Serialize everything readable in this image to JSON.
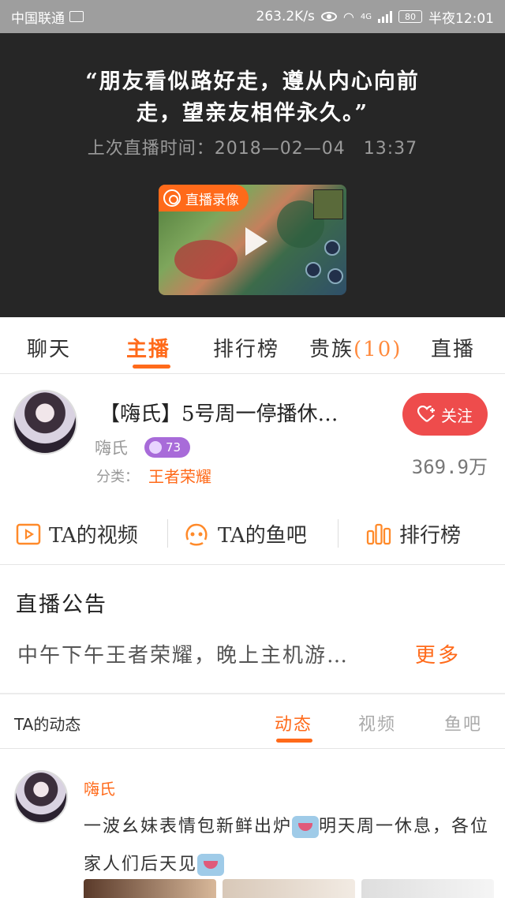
{
  "status_bar": {
    "carrier": "中国联通",
    "speed": "263.2K/s",
    "network": "4G",
    "battery": "80",
    "time": "半夜12:01"
  },
  "hero": {
    "quote_line1": "“朋友看似路好走，遵从内心向前",
    "quote_line2": "走，望亲友相伴永久。”",
    "last_live": "上次直播时间：2018—02—04　13:37",
    "replay_label": "直播录像"
  },
  "tabs": [
    {
      "label": "聊天"
    },
    {
      "label": "主播"
    },
    {
      "label": "排行榜"
    },
    {
      "label": "贵族",
      "count": "(10)"
    },
    {
      "label": "直播"
    }
  ],
  "anchor": {
    "title": "【嗨氏】5号周一停播休…",
    "name": "嗨氏",
    "level": "73",
    "category_label": "分类：",
    "category": "王者荣耀",
    "follow_label": "关注",
    "fans": "369.9万"
  },
  "actions": [
    {
      "label": "TA的视频",
      "icon": "video-icon"
    },
    {
      "label": "TA的鱼吧",
      "icon": "fishbar-icon"
    },
    {
      "label": "排行榜",
      "icon": "ranking-icon"
    }
  ],
  "notice": {
    "title": "直播公告",
    "text": "中午下午王者荣耀，晚上主机游…",
    "more": "更多"
  },
  "dynamics": {
    "label": "TA的动态",
    "tabs": [
      "动态",
      "视频",
      "鱼吧"
    ]
  },
  "post": {
    "author": "嗨氏",
    "text_part1": "一波幺妹表情包新鲜出炉",
    "text_part2": "明天周一休息，各位家人们后天见"
  },
  "colors": {
    "accent": "#ff6a1a",
    "follow": "#ee4c4c",
    "hero_bg": "#262626"
  }
}
